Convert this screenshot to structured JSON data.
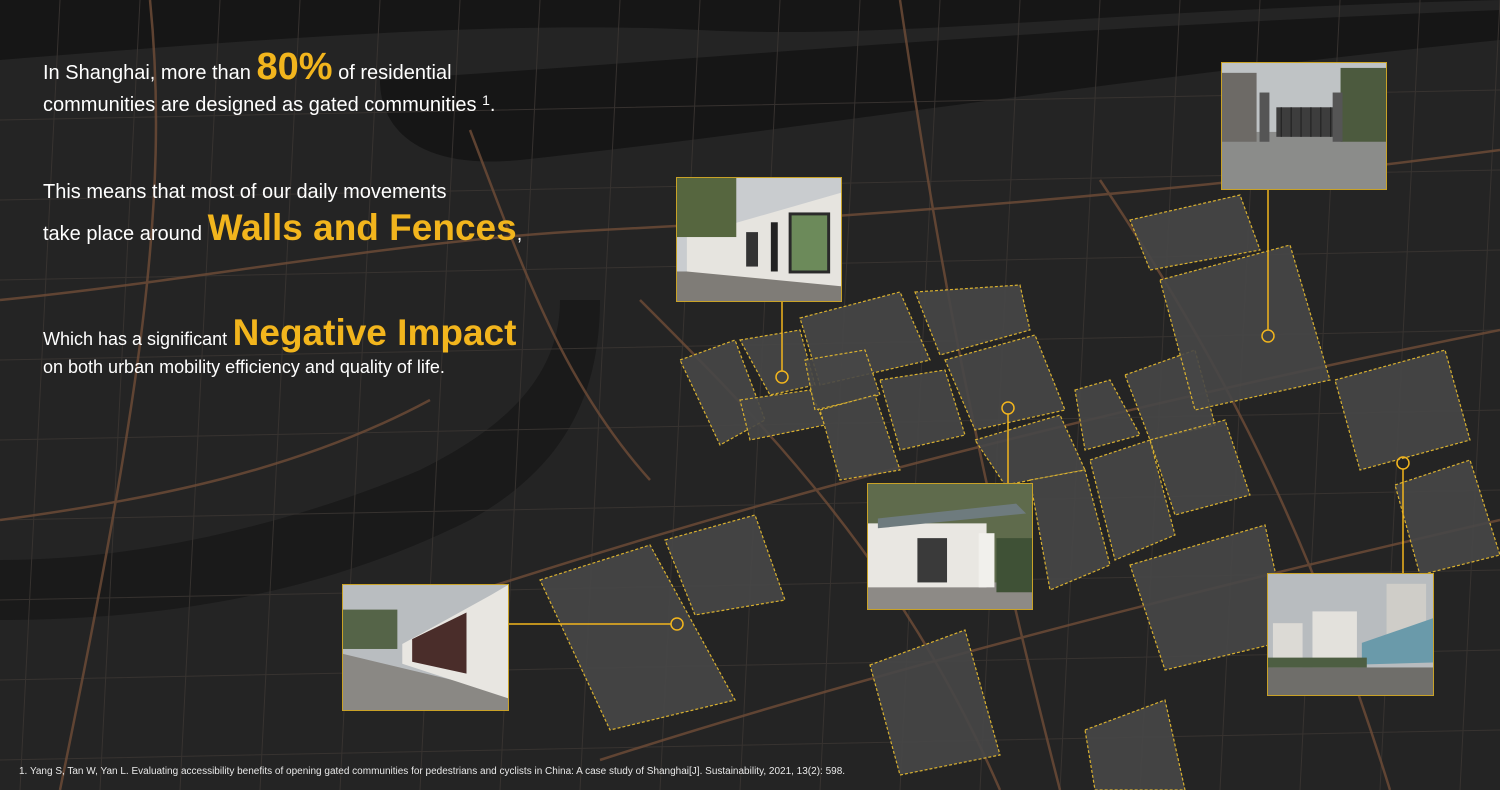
{
  "colors": {
    "accent": "#f2b51d",
    "background": "#232323",
    "river": "#151515",
    "block_fill": "#464646",
    "block_outline": "#d8b030",
    "road": "#6b4a36"
  },
  "headline": {
    "line1_prefix": "In Shanghai, more than",
    "line1_stat": "80%",
    "line1_suffix": "of residential",
    "line2": "communities are designed as gated communities",
    "line2_sup": "1",
    "line2_end": "."
  },
  "movement": {
    "line1": "This means that most of our daily movements",
    "line2_prefix": "take place around",
    "line2_highlight": "Walls and Fences",
    "line2_end": ","
  },
  "impact": {
    "line1_prefix": "Which has a significant",
    "line1_highlight": "Negative Impact",
    "line2": "on both urban mobility efficiency and quality of life."
  },
  "footnote": "1. Yang S, Tan W, Yan L. Evaluating accessibility benefits of opening gated communities for pedestrians and cyclists in China: A case study of Shanghai[J]. Sustainability, 2021, 13(2): 598.",
  "photos": [
    "gate-entrance-photo",
    "wall-mural-photo",
    "courtyard-gate-photo",
    "fence-banner-photo",
    "apartment-fence-photo"
  ]
}
